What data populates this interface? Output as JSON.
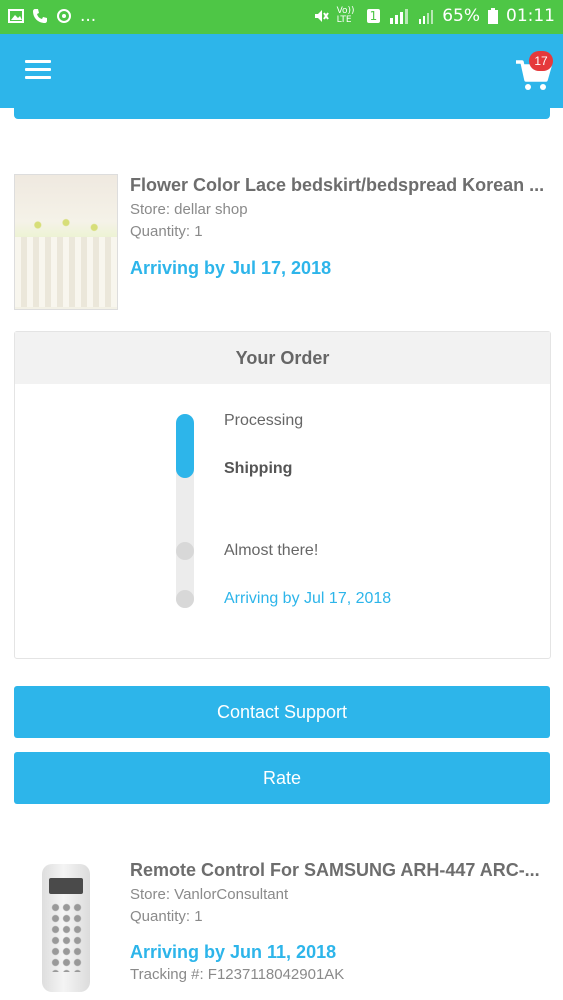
{
  "status_bar": {
    "left_icons": [
      "image-icon",
      "phone-icon",
      "sync-icon"
    ],
    "left_more": "...",
    "volte_label": "Vo)) LTE",
    "sim_label": "1",
    "battery_percent": "65%",
    "time": "01:11"
  },
  "app_bar": {
    "menu_icon": "hamburger-icon",
    "cart_icon": "cart-icon",
    "cart_count": "17"
  },
  "orders": [
    {
      "title": "Flower Color Lace bedskirt/bedspread Korean ...",
      "store": "Store: dellar shop",
      "quantity": "Quantity: 1",
      "arriving": "Arriving by Jul 17, 2018"
    },
    {
      "title": "Remote Control For SAMSUNG ARH-447 ARC-...",
      "store": "Store: VanlorConsultant",
      "quantity": "Quantity: 1",
      "arriving": "Arriving by Jun 11, 2018",
      "tracking": "Tracking #: F1237118042901AK"
    }
  ],
  "your_order": {
    "heading": "Your Order",
    "steps": [
      "Processing",
      "Shipping",
      "Almost there!",
      "Arriving by Jul 17, 2018"
    ],
    "current_step_index": 1
  },
  "buttons": {
    "contact_support": "Contact Support",
    "rate": "Rate"
  },
  "colors": {
    "status_bar": "#4ec646",
    "accent": "#2db5ea",
    "badge": "#e5393b"
  }
}
